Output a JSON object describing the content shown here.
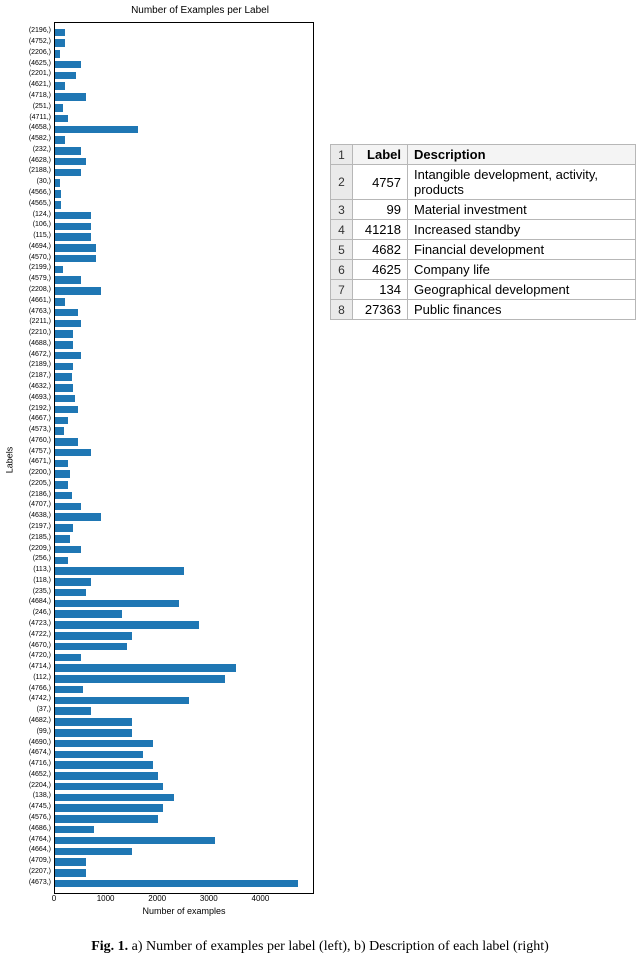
{
  "chart_data": {
    "type": "bar",
    "orientation": "horizontal",
    "title": "Number of Examples per Label",
    "xlabel": "Number of examples",
    "ylabel": "Labels",
    "xlim": [
      0,
      5000
    ],
    "xticks": [
      0,
      1000,
      2000,
      3000,
      4000
    ],
    "categories": [
      "(2196,)",
      "(4752,)",
      "(2206,)",
      "(4625,)",
      "(2201,)",
      "(4621,)",
      "(4718,)",
      "(251,)",
      "(4711,)",
      "(4658,)",
      "(4582,)",
      "(232,)",
      "(4628,)",
      "(2188,)",
      "(30,)",
      "(4566,)",
      "(4565,)",
      "(124,)",
      "(106,)",
      "(115,)",
      "(4694,)",
      "(4570,)",
      "(2199,)",
      "(4579,)",
      "(2208,)",
      "(4661,)",
      "(4763,)",
      "(2211,)",
      "(2210,)",
      "(4688,)",
      "(4672,)",
      "(2189,)",
      "(2187,)",
      "(4632,)",
      "(4693,)",
      "(2192,)",
      "(4667,)",
      "(4573,)",
      "(4760,)",
      "(4757,)",
      "(4671,)",
      "(2200,)",
      "(2205,)",
      "(2186,)",
      "(4707,)",
      "(4638,)",
      "(2197,)",
      "(2185,)",
      "(2209,)",
      "(256,)",
      "(113,)",
      "(118,)",
      "(235,)",
      "(4684,)",
      "(246,)",
      "(4723,)",
      "(4722,)",
      "(4670,)",
      "(4720,)",
      "(4714,)",
      "(112,)",
      "(4766,)",
      "(4742,)",
      "(37,)",
      "(4682,)",
      "(99,)",
      "(4690,)",
      "(4674,)",
      "(4716,)",
      "(4652,)",
      "(2204,)",
      "(138,)",
      "(4745,)",
      "(4576,)",
      "(4686,)",
      "(4764,)",
      "(4664,)",
      "(4709,)",
      "(2207,)",
      "(4673,)"
    ],
    "values": [
      200,
      200,
      100,
      500,
      400,
      200,
      600,
      150,
      250,
      1600,
      200,
      500,
      600,
      500,
      100,
      120,
      120,
      700,
      700,
      700,
      800,
      800,
      150,
      500,
      900,
      200,
      450,
      500,
      350,
      350,
      500,
      350,
      320,
      350,
      380,
      450,
      250,
      180,
      450,
      700,
      250,
      300,
      250,
      320,
      500,
      900,
      350,
      300,
      500,
      250,
      2500,
      700,
      600,
      2400,
      1300,
      2800,
      1500,
      1400,
      500,
      3500,
      3300,
      550,
      2600,
      700,
      1500,
      1500,
      1900,
      1700,
      1900,
      2000,
      2100,
      2300,
      2100,
      2000,
      750,
      3100,
      1500,
      600,
      600,
      4700
    ],
    "color": "#1f77b4"
  },
  "description_table": {
    "headers": {
      "row": "",
      "label": "Label",
      "desc": "Description"
    },
    "rows": [
      {
        "n": "1",
        "label": "",
        "desc": ""
      },
      {
        "n": "2",
        "label": "4757",
        "desc": "Intangible development, activity, products"
      },
      {
        "n": "3",
        "label": "99",
        "desc": "Material investment"
      },
      {
        "n": "4",
        "label": "41218",
        "desc": "Increased standby"
      },
      {
        "n": "5",
        "label": "4682",
        "desc": "Financial development"
      },
      {
        "n": "6",
        "label": "4625",
        "desc": "Company life"
      },
      {
        "n": "7",
        "label": "134",
        "desc": "Geographical development"
      },
      {
        "n": "8",
        "label": "27363",
        "desc": "Public finances"
      }
    ]
  },
  "caption": {
    "prefix": "Fig. 1.",
    "text": " a) Number of examples per label (left), b) Description of each label (right)"
  }
}
